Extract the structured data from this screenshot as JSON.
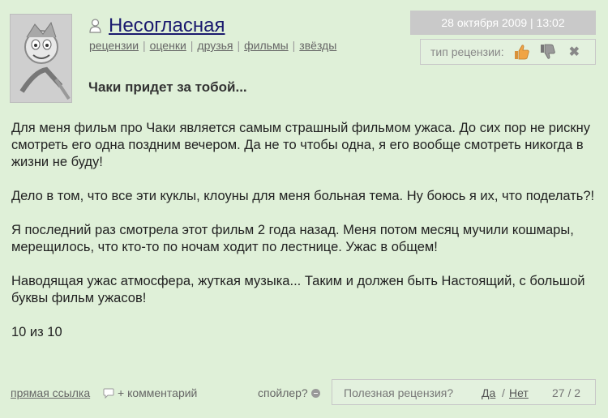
{
  "user": {
    "name": "Несогласная",
    "links": [
      "рецензии",
      "оценки",
      "друзья",
      "фильмы",
      "звёзды"
    ]
  },
  "review": {
    "date": "28 октября 2009 | 13:02",
    "type_label": "тип рецензии:",
    "title": "Чаки придет за тобой...",
    "paragraphs": [
      "Для меня фильм про Чаки является самым страшный фильмом ужаса. До сих пор не рискну смотреть его одна поздним вечером. Да не то чтобы одна, я его вообще смотреть никогда в жизни не буду!",
      "Дело в том, что все эти куклы, клоуны для меня больная тема. Ну боюсь я их, что поделать?!",
      "Я последний раз смотрела этот фильм 2 года назад. Меня потом месяц мучили кошмары, мерещилось, что кто-то по ночам ходит по лестнице. Ужас в общем!",
      "Наводящая ужас атмосфера, жуткая музыка... Таким и должен быть Настоящий, с большой буквы фильм ужасов!",
      "10 из 10"
    ]
  },
  "footer": {
    "direct_link": "прямая ссылка",
    "add_comment": "+ комментарий",
    "spoiler": "спойлер?",
    "useful_question": "Полезная рецензия?",
    "yes": "Да",
    "slash": "/",
    "no": "Нет",
    "votes": "27 / 2"
  }
}
